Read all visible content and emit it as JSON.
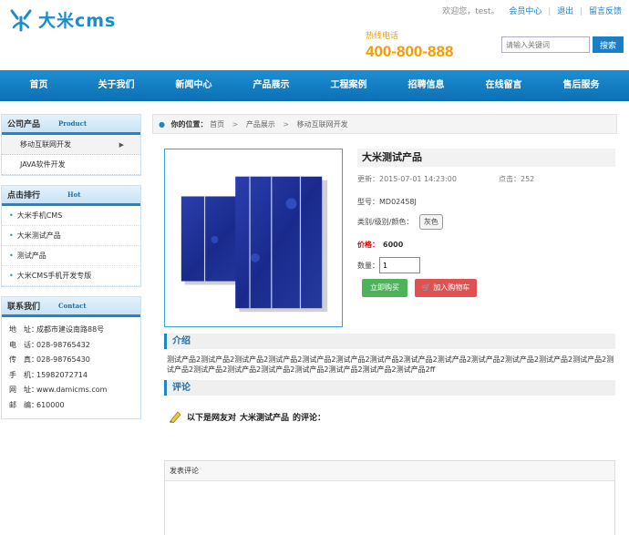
{
  "header": {
    "logo_text": "大米cms",
    "welcome": "欢迎您，test。",
    "member_center": "会员中心",
    "logout": "退出",
    "feedback": "留言反馈",
    "hotline_label": "热线电话",
    "hotline_number": "400-800-888",
    "search_placeholder": "请输入关键词",
    "search_button": "搜索",
    "accent_color": "#1c8cc7",
    "hotline_color": "#f59b00"
  },
  "nav": {
    "items": [
      "首页",
      "关于我们",
      "新闻中心",
      "产品展示",
      "工程案例",
      "招聘信息",
      "在线留言",
      "售后服务"
    ]
  },
  "sidebar": {
    "products": {
      "title": "公司产品",
      "title_en": "Product",
      "items": [
        "移动互联网开发",
        "JAVA软件开发"
      ]
    },
    "hot": {
      "title": "点击排行",
      "title_en": "Hot",
      "items": [
        "大米手机CMS",
        "大米测试产品",
        "测试产品",
        "大米CMS手机开发专版"
      ]
    },
    "contact": {
      "title": "联系我们",
      "title_en": "Contact",
      "rows": [
        {
          "k": "地　址：",
          "v": "成都市建设南路88号"
        },
        {
          "k": "电　话：",
          "v": "028-98765432"
        },
        {
          "k": "传　真：",
          "v": "028-98765430"
        },
        {
          "k": "手　机：",
          "v": "15982072714"
        },
        {
          "k": "网　址：",
          "v": "www.damicms.com"
        },
        {
          "k": "邮　编：",
          "v": "610000"
        }
      ]
    }
  },
  "breadcrumb": {
    "label": "你的位置：",
    "items": [
      "首页",
      "产品展示",
      "移动互联网开发"
    ]
  },
  "product": {
    "title": "大米测试产品",
    "updated_label": "更新：",
    "updated": "2015-07-01 14:23:00",
    "clicks_label": "点击：",
    "clicks": "252",
    "model_label": "型号：",
    "model": "MD02458J",
    "variant_label": "类别/级别/颜色：",
    "variant": "灰色",
    "price_label": "价格：",
    "price": "6000",
    "qty_label": "数量：",
    "qty": "1",
    "buy_now": "立即购买",
    "add_cart": "加入购物车"
  },
  "sections": {
    "intro_title": "介绍",
    "intro_text": "测试产品2测试产品2测试产品2测试产品2测试产品2测试产品2测试产品2测试产品2测试产品2测试产品2测试产品2测试产品2测试产品2测试产品2测试产品2测试产品2测试产品2测试产品2测试产品2测试产品2测试产品2ff",
    "comments_title": "评论",
    "comment_prefix": "以下是网友对",
    "comment_product": "大米测试产品",
    "comment_suffix": "的评论：",
    "post_comment": "发表评论"
  }
}
